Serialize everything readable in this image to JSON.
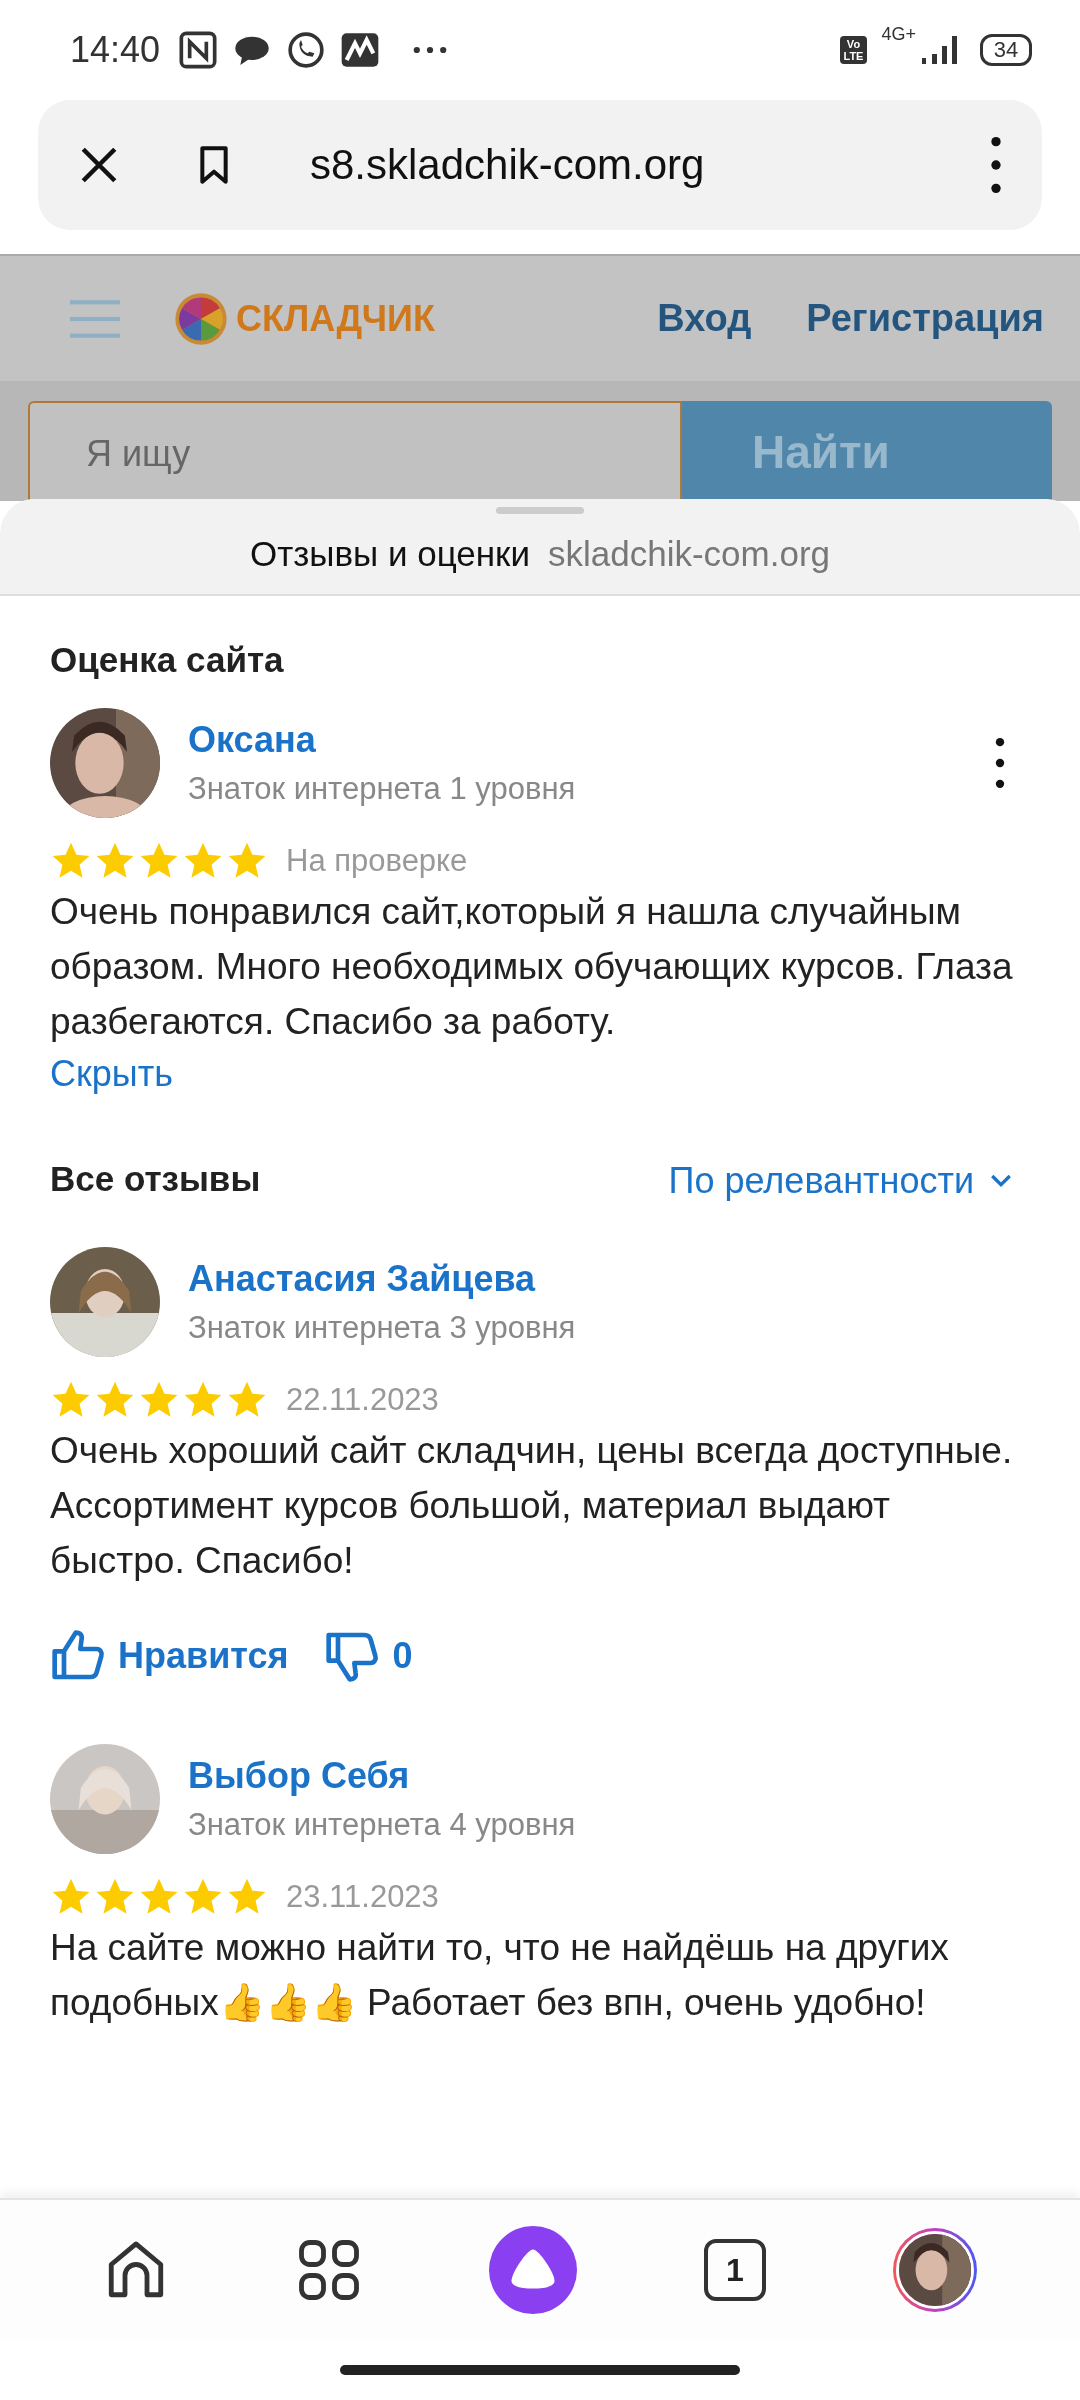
{
  "status_bar": {
    "time": "14:40",
    "network_badge": "Vo\nLTE",
    "network_type": "4G+",
    "battery": "34"
  },
  "browser": {
    "url": "s8.skladchik-com.org"
  },
  "site_header": {
    "logo_text": "СКЛАДЧИК",
    "login": "Вход",
    "register": "Регистрация"
  },
  "site_search": {
    "placeholder": "Я ищу",
    "button": "Найти"
  },
  "sheet": {
    "title": "Отзывы и оценки",
    "domain": "skladchik-com.org"
  },
  "my_rating": {
    "heading": "Оценка сайта",
    "review": {
      "name": "Оксана",
      "level": "Знаток интернета 1 уровня",
      "stars": 5,
      "meta": "На проверке",
      "text": "Очень понравился сайт,который я нашла случайным образом. Много необходимых обучающих курсов. Глаза разбегаются. Спасибо за работу.",
      "hide_link": "Скрыть"
    }
  },
  "all_reviews": {
    "heading": "Все отзывы",
    "sort": "По релевантности",
    "reviews": [
      {
        "name": "Анастасия Зайцева",
        "level": "Знаток интернета 3 уровня",
        "stars": 5,
        "meta": "22.11.2023",
        "text": "Очень хороший сайт складчин, цены всегда доступные. Ассортимент курсов большой, материал выдают быстро. Спасибо!",
        "like_label": "Нравится",
        "dislike_count": "0"
      },
      {
        "name": "Выбор Себя",
        "level": "Знаток интернета 4 уровня",
        "stars": 5,
        "meta": "23.11.2023",
        "text": "На сайте можно найти то, что не найдёшь на других подобных👍👍👍 Работает без впн, очень удобно!"
      }
    ]
  },
  "bottom_nav": {
    "tabs_count": "1"
  }
}
